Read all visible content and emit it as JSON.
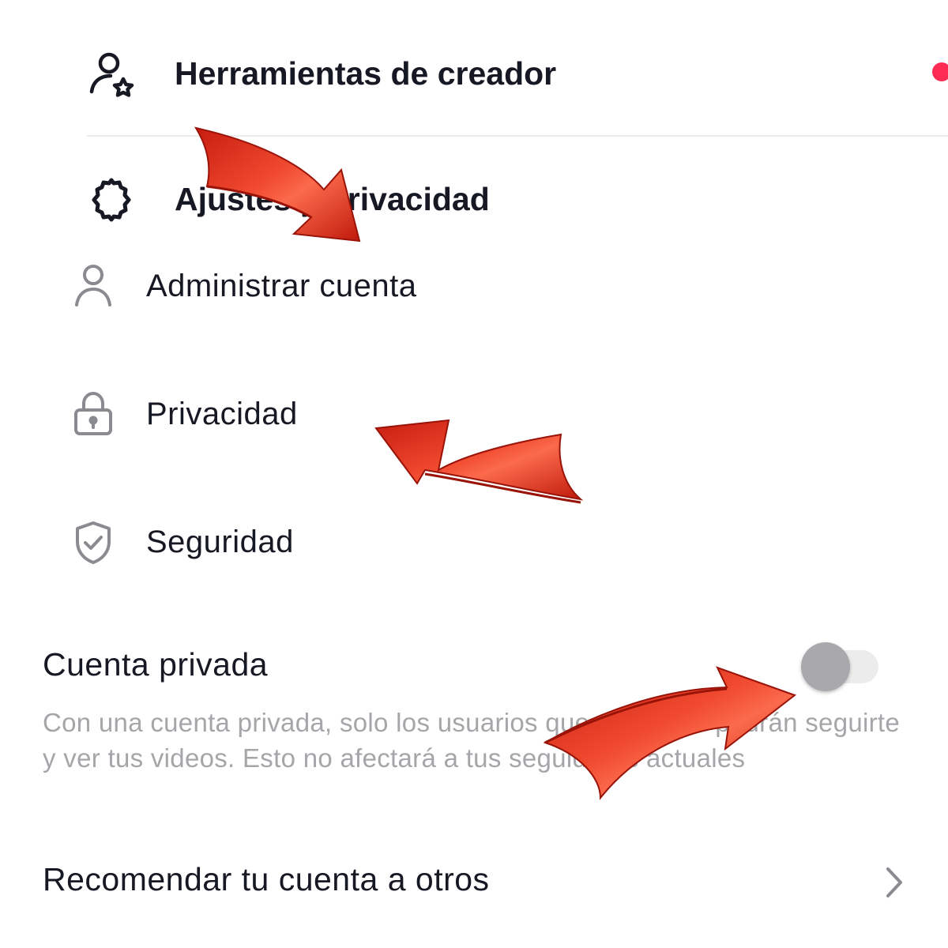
{
  "creator_tools": {
    "label": "Herramientas de creador",
    "icon": "person-star-icon",
    "badge_color": "#fe2c55"
  },
  "settings": {
    "label": "Ajustes y privacidad",
    "icon": "gear-icon"
  },
  "menu": [
    {
      "label": "Administrar cuenta",
      "icon": "person-icon"
    },
    {
      "label": "Privacidad",
      "icon": "lock-icon"
    },
    {
      "label": "Seguridad",
      "icon": "shield-check-icon"
    }
  ],
  "private_account": {
    "label": "Cuenta privada",
    "enabled": false,
    "description": "Con una cuenta privada, solo los usuarios que apruebes podrán seguirte y ver tus videos. Esto no afectará a tus seguidores actuales"
  },
  "recommend": {
    "label": "Recomendar tu cuenta a otros",
    "icon": "chevron-right-icon"
  },
  "annotation_color": "#e8321c"
}
